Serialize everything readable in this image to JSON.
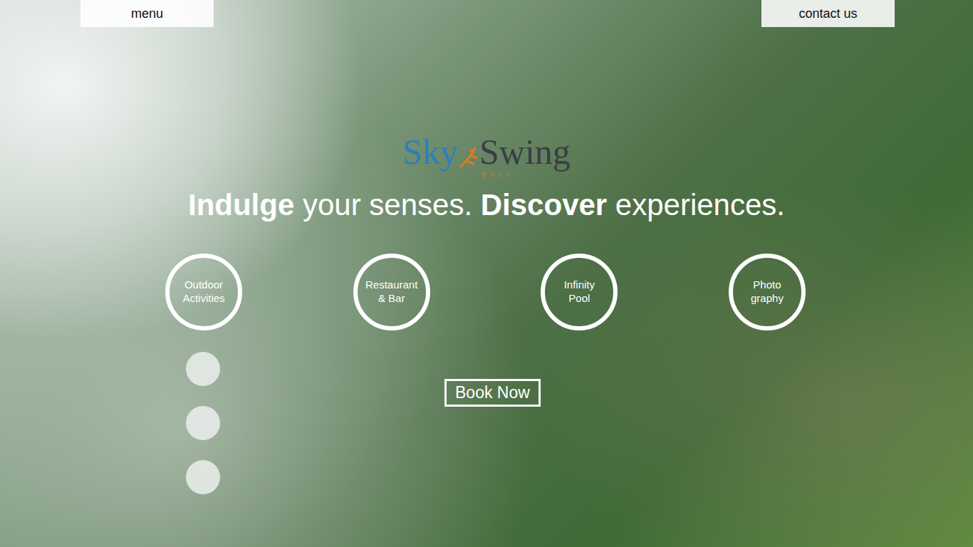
{
  "header": {
    "menu": "menu",
    "contact": "contact us"
  },
  "logo": {
    "sky": "Sky",
    "swing": "Swing",
    "place": "BALI"
  },
  "tagline": [
    {
      "text": "Indulge",
      "bold": true
    },
    {
      "text": " your senses. ",
      "bold": false
    },
    {
      "text": "Discover",
      "bold": true
    },
    {
      "text": " experiences.",
      "bold": false
    }
  ],
  "features": [
    {
      "lines": [
        "Outdoor",
        "Activities"
      ]
    },
    {
      "lines": [
        "Restaurant",
        "& Bar"
      ]
    },
    {
      "lines": [
        "Infinity",
        "Pool"
      ]
    },
    {
      "lines": [
        "Photo",
        "graphy"
      ]
    }
  ],
  "dots": [
    {
      "selected": false
    },
    {
      "selected": false
    },
    {
      "selected": false
    }
  ],
  "book_button": "Book Now"
}
